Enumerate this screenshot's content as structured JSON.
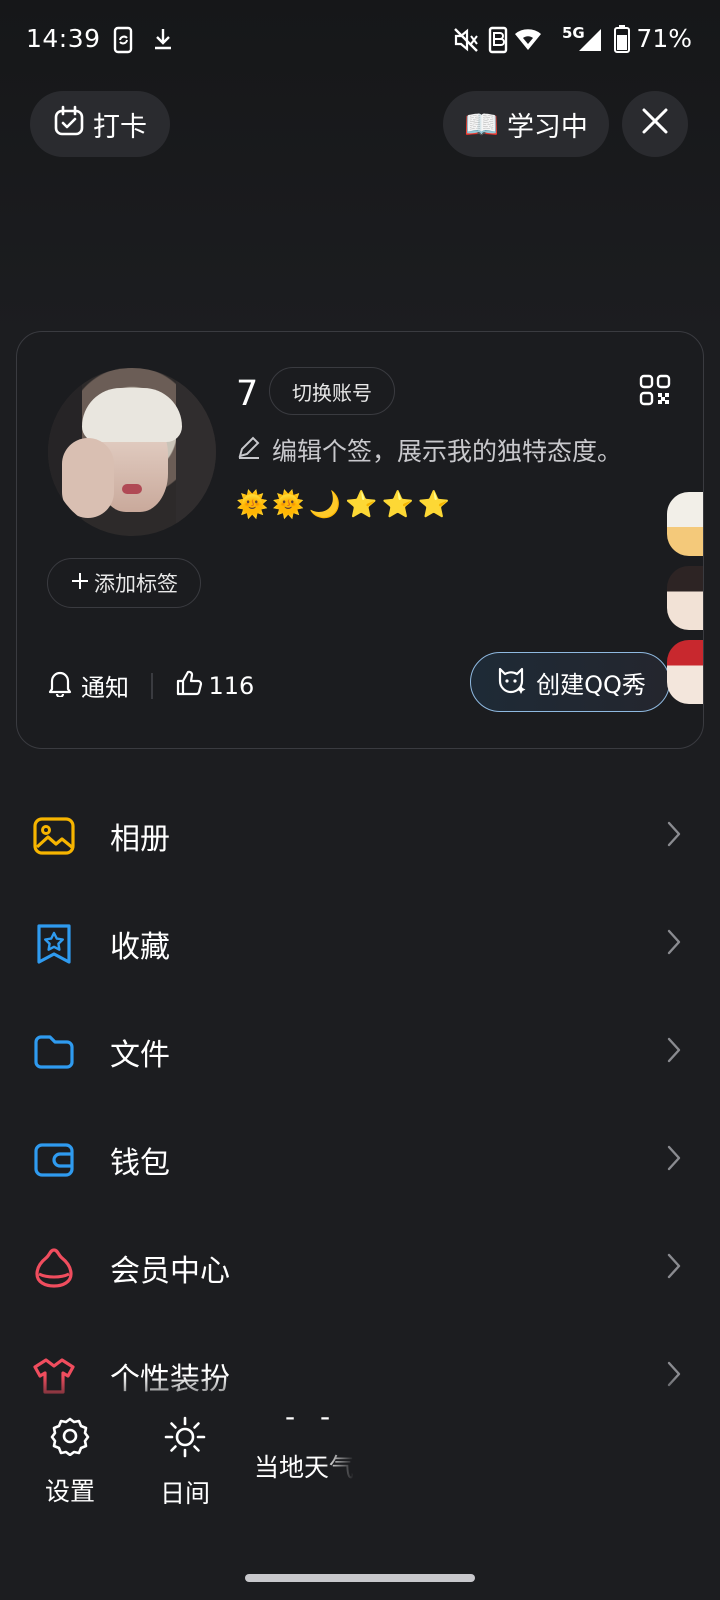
{
  "status_bar": {
    "time": "14:39",
    "network": "5G",
    "battery": "71%"
  },
  "top_actions": {
    "checkin_label": "打卡",
    "study_label": "学习中",
    "study_emoji": "📖"
  },
  "profile": {
    "username": "7",
    "switch_account_label": "切换账号",
    "signature": "编辑个签，展示我的独特态度。",
    "status_icons": [
      "🌞",
      "🌞",
      "🌙",
      "⭐",
      "⭐",
      "⭐"
    ],
    "add_tag_label": "添加标签",
    "notify_label": "通知",
    "likes_count": "116",
    "create_show_label": "创建QQ秀"
  },
  "menu": [
    {
      "label": "相册",
      "icon": "album-icon",
      "color": "#f7b500"
    },
    {
      "label": "收藏",
      "icon": "favorites-icon",
      "color": "#2f9bf0"
    },
    {
      "label": "文件",
      "icon": "folder-icon",
      "color": "#2f9bf0"
    },
    {
      "label": "钱包",
      "icon": "wallet-icon",
      "color": "#2f9bf0"
    },
    {
      "label": "会员中心",
      "icon": "vip-icon",
      "color": "#f04d5e"
    },
    {
      "label": "个性装扮",
      "icon": "dress-up-icon",
      "color": "#f04d5e"
    }
  ],
  "bottom_bar": {
    "settings_label": "设置",
    "daymode_label": "日间",
    "weather_value": "- -",
    "weather_label": "当地天气"
  },
  "colors": {
    "background": "#1c1d20",
    "card_border": "#3a3b40",
    "accent_yellow": "#f7b500",
    "accent_blue": "#2f9bf0",
    "accent_red": "#f04d5e"
  }
}
